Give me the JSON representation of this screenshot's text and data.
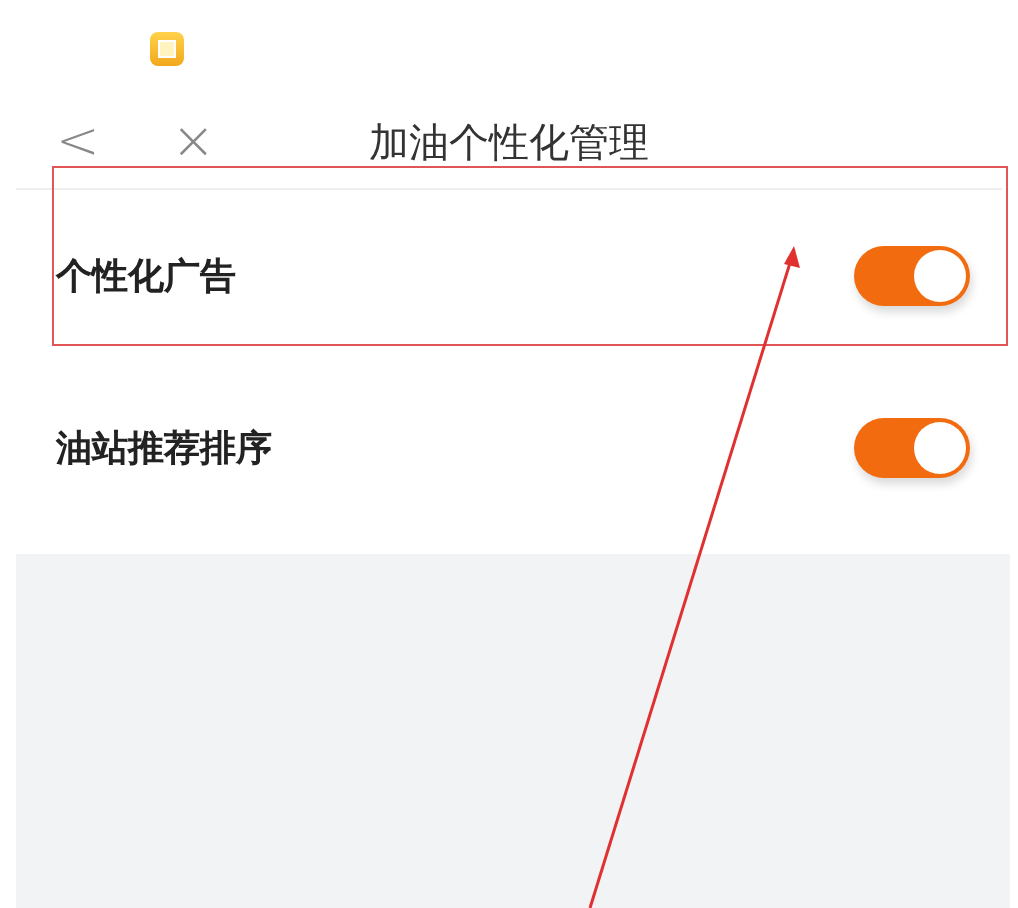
{
  "nav_bar": {
    "back": "<",
    "close": "×",
    "title": "加油个性化管理"
  },
  "settings": [
    {
      "label": "个性化广告",
      "on": true
    },
    {
      "label": "油站推荐排序",
      "on": true
    }
  ]
}
